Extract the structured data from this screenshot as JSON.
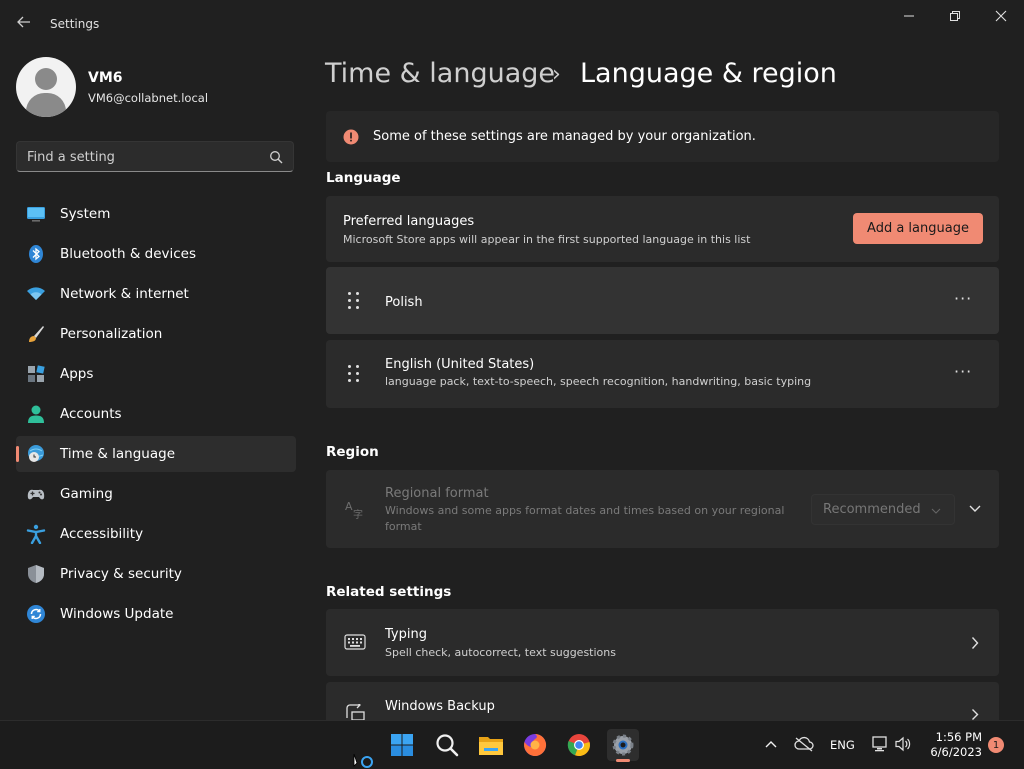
{
  "window": {
    "title": "Settings",
    "back_icon": "back-arrow-icon",
    "controls": [
      "minimize-icon",
      "restore-icon",
      "close-icon"
    ]
  },
  "profile": {
    "name": "VM6",
    "email": "VM6@collabnet.local"
  },
  "search": {
    "placeholder": "Find a setting"
  },
  "sidebar": {
    "items": [
      {
        "label": "System",
        "icon": "monitor-icon"
      },
      {
        "label": "Bluetooth & devices",
        "icon": "bluetooth-icon"
      },
      {
        "label": "Network & internet",
        "icon": "wifi-icon"
      },
      {
        "label": "Personalization",
        "icon": "brush-icon"
      },
      {
        "label": "Apps",
        "icon": "apps-icon"
      },
      {
        "label": "Accounts",
        "icon": "person-icon"
      },
      {
        "label": "Time & language",
        "icon": "globe-clock-icon",
        "active": true
      },
      {
        "label": "Gaming",
        "icon": "gamepad-icon"
      },
      {
        "label": "Accessibility",
        "icon": "accessibility-icon"
      },
      {
        "label": "Privacy & security",
        "icon": "shield-icon"
      },
      {
        "label": "Windows Update",
        "icon": "update-icon"
      }
    ]
  },
  "header": {
    "parent": "Time & language",
    "separator": "›",
    "current": "Language & region"
  },
  "banner": {
    "text": "Some of these settings are managed by your organization.",
    "icon": "info-icon"
  },
  "language": {
    "heading": "Language",
    "preferred_title": "Preferred languages",
    "preferred_desc": "Microsoft Store apps will appear in the first supported language in this list",
    "add_button": "Add a language",
    "languages": [
      {
        "name": "Polish",
        "detail": ""
      },
      {
        "name": "English (United States)",
        "detail": "language pack, text-to-speech, speech recognition, handwriting, basic typing"
      }
    ],
    "more_label": "···"
  },
  "region": {
    "heading": "Region",
    "format_title": "Regional format",
    "format_desc_line1": "Windows and some apps format dates and times based on your regional",
    "format_desc_line2": "format",
    "format_value": "Recommended"
  },
  "related": {
    "heading": "Related settings",
    "items": [
      {
        "title": "Typing",
        "desc": "Spell check, autocorrect, text suggestions",
        "icon": "keyboard-icon"
      },
      {
        "title": "Windows Backup",
        "desc": "",
        "icon": "backup-icon"
      }
    ]
  },
  "taskbar": {
    "apps": [
      "windows-start-icon",
      "search-icon",
      "file-explorer-icon",
      "firefox-icon",
      "chrome-icon",
      "settings-gear-icon"
    ],
    "tray": {
      "language": "ENG",
      "time": "1:56 PM",
      "date": "6/6/2023",
      "notifications": "1"
    }
  },
  "colors": {
    "accent": "#f08a73",
    "background": "#202020",
    "card": "#2b2b2b"
  }
}
